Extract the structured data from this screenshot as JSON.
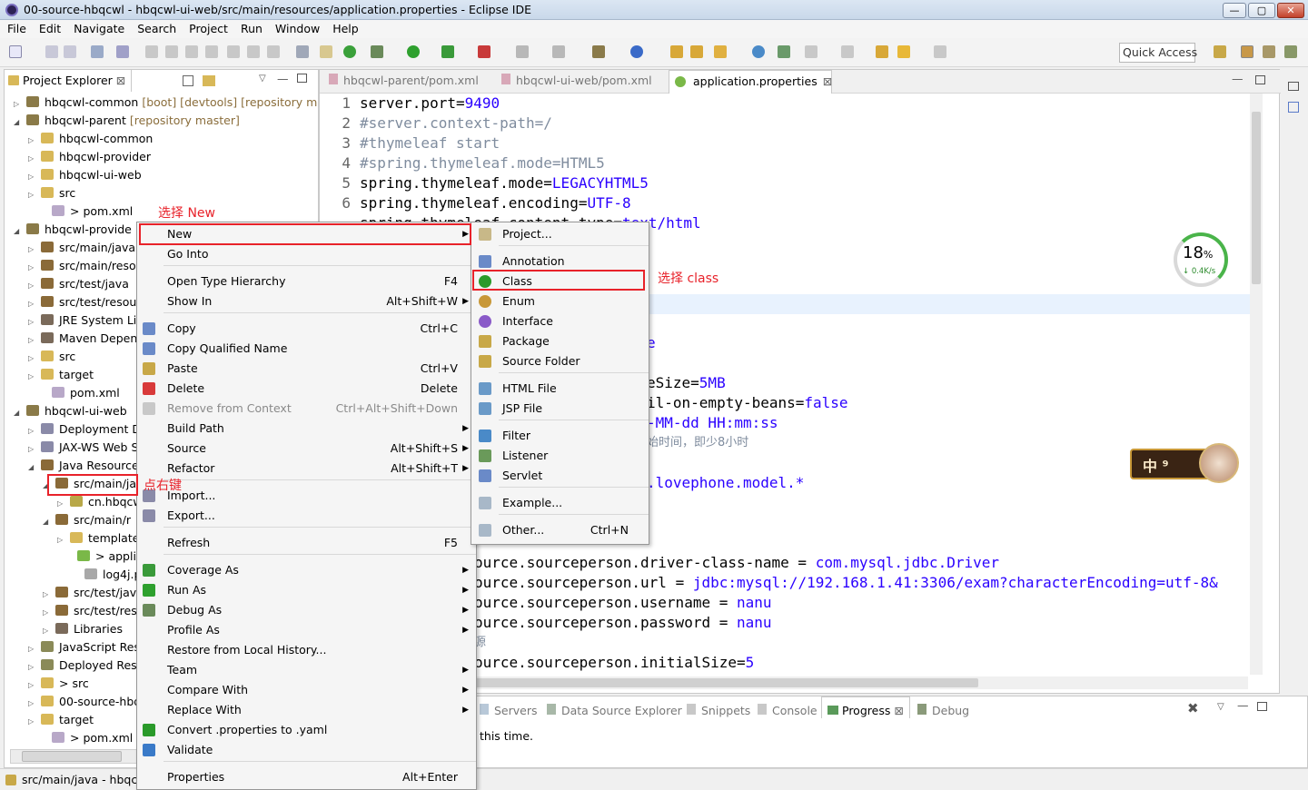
{
  "window": {
    "title": "00-source-hbqcwl - hbqcwl-ui-web/src/main/resources/application.properties - Eclipse IDE",
    "min": "—",
    "max": "▢",
    "close": "✕"
  },
  "menu": [
    "File",
    "Edit",
    "Navigate",
    "Search",
    "Project",
    "Run",
    "Window",
    "Help"
  ],
  "quick_access": "Quick Access",
  "explorer": {
    "tab": "Project Explorer",
    "rows": [
      {
        "t": "hbqcwl-common",
        "d": "[boot] [devtools] [repository ma:"
      },
      {
        "t": "hbqcwl-parent",
        "d": "[repository master]"
      },
      {
        "t": "hbqcwl-common",
        "d": ""
      },
      {
        "t": "hbqcwl-provider",
        "d": ""
      },
      {
        "t": "hbqcwl-ui-web",
        "d": ""
      },
      {
        "t": "src",
        "d": ""
      },
      {
        "t": "> pom.xml",
        "d": ""
      },
      {
        "t": "hbqcwl-provide",
        "d": ""
      },
      {
        "t": "src/main/java",
        "d": ""
      },
      {
        "t": "src/main/resou",
        "d": ""
      },
      {
        "t": "src/test/java",
        "d": ""
      },
      {
        "t": "src/test/resourc",
        "d": ""
      },
      {
        "t": "JRE System Libr",
        "d": ""
      },
      {
        "t": "Maven Depend",
        "d": ""
      },
      {
        "t": "src",
        "d": ""
      },
      {
        "t": "target",
        "d": ""
      },
      {
        "t": "pom.xml",
        "d": ""
      },
      {
        "t": "hbqcwl-ui-web",
        "d": ""
      },
      {
        "t": "Deployment De",
        "d": ""
      },
      {
        "t": "JAX-WS Web Se",
        "d": ""
      },
      {
        "t": "Java Resources",
        "d": ""
      },
      {
        "t": "src/main/java",
        "d": ""
      },
      {
        "t": "cn.hbqcwl",
        "d": ""
      },
      {
        "t": "src/main/r",
        "d": ""
      },
      {
        "t": "templates",
        "d": ""
      },
      {
        "t": "> applicat",
        "d": ""
      },
      {
        "t": "log4j.prop",
        "d": ""
      },
      {
        "t": "src/test/java",
        "d": ""
      },
      {
        "t": "src/test/reso",
        "d": ""
      },
      {
        "t": "Libraries",
        "d": ""
      },
      {
        "t": "JavaScript Reso",
        "d": ""
      },
      {
        "t": "Deployed Reso",
        "d": ""
      },
      {
        "t": "> src",
        "d": ""
      },
      {
        "t": "00-source-hbqc",
        "d": ""
      },
      {
        "t": "target",
        "d": ""
      },
      {
        "t": "> pom.xml",
        "d": ""
      }
    ]
  },
  "editor": {
    "tabs": [
      "hbqcwl-parent/pom.xml",
      "hbqcwl-ui-web/pom.xml",
      "application.properties"
    ],
    "lines": [
      {
        "n": "1",
        "k": "server.port=",
        "v": "9490",
        "c": ""
      },
      {
        "n": "2",
        "k": "",
        "v": "",
        "c": "#server.context-path=/"
      },
      {
        "n": "3",
        "k": "",
        "v": "",
        "c": "#thymeleaf start"
      },
      {
        "n": "4",
        "k": "",
        "v": "",
        "c": "#spring.thymeleaf.mode=HTML5"
      },
      {
        "n": "5",
        "k": "spring.thymeleaf.mode=",
        "v": "LEGACYHTML5",
        "c": ""
      },
      {
        "n": "6",
        "k": "spring.thymeleaf.encoding=",
        "v": "UTF-8",
        "c": ""
      },
      {
        "n": "",
        "k": "spring.thymeleaf.content-type=",
        "v": "text/html",
        "c": ""
      }
    ],
    "frag": {
      "e": "e",
      "size": "eSize=",
      "size_v": "5MB",
      "fail": "il-on-empty-beans=",
      "fail_v": "false",
      "date": "-MM-dd HH:mm:ss",
      "note": "始时间，即少8小时",
      "model": ".lovephone.model.*",
      "ds1k": "ource.sourceperson.driver-class-name",
      "ds1v": "com.mysql.jdbc.Driver",
      "ds2k": "ource.sourceperson.url",
      "ds2v": "jdbc:mysql://192.168.1.41:3306/exam?characterEncoding=utf-8&",
      "ds3k": "ource.sourceperson.username",
      "ds3v": "nanu",
      "ds4k": "ource.sourceperson.password",
      "ds4v": "nanu",
      "src": "源",
      "ds5k": "ource.sourceperson.initialSize=",
      "ds5v": "5",
      "eqs": "="
    }
  },
  "speed": {
    "pct": "18",
    "unit": "%",
    "rate": "↓ 0.4K/s"
  },
  "badge": {
    "text": "中 ⁹"
  },
  "bottom": {
    "tabs": [
      "Servers",
      "Data Source Explorer",
      "Snippets",
      "Console",
      "Progress",
      "Debug"
    ],
    "msg": "this time."
  },
  "status": {
    "text": "src/main/java - hbqcw"
  },
  "context_menu": [
    {
      "l": "New",
      "s": "",
      "a": true
    },
    {
      "l": "Go Into",
      "s": "",
      "a": false
    },
    {
      "l": "Open Type Hierarchy",
      "s": "F4",
      "a": false
    },
    {
      "l": "Show In",
      "s": "Alt+Shift+W",
      "a": true
    },
    {
      "l": "Copy",
      "s": "Ctrl+C",
      "a": false
    },
    {
      "l": "Copy Qualified Name",
      "s": "",
      "a": false
    },
    {
      "l": "Paste",
      "s": "Ctrl+V",
      "a": false
    },
    {
      "l": "Delete",
      "s": "Delete",
      "a": false
    },
    {
      "l": "Remove from Context",
      "s": "Ctrl+Alt+Shift+Down",
      "a": false
    },
    {
      "l": "Build Path",
      "s": "",
      "a": true
    },
    {
      "l": "Source",
      "s": "Alt+Shift+S",
      "a": true
    },
    {
      "l": "Refactor",
      "s": "Alt+Shift+T",
      "a": true
    },
    {
      "l": "Import...",
      "s": "",
      "a": false
    },
    {
      "l": "Export...",
      "s": "",
      "a": false
    },
    {
      "l": "Refresh",
      "s": "F5",
      "a": false
    },
    {
      "l": "Coverage As",
      "s": "",
      "a": true
    },
    {
      "l": "Run As",
      "s": "",
      "a": true
    },
    {
      "l": "Debug As",
      "s": "",
      "a": true
    },
    {
      "l": "Profile As",
      "s": "",
      "a": true
    },
    {
      "l": "Restore from Local History...",
      "s": "",
      "a": false
    },
    {
      "l": "Team",
      "s": "",
      "a": true
    },
    {
      "l": "Compare With",
      "s": "",
      "a": true
    },
    {
      "l": "Replace With",
      "s": "",
      "a": true
    },
    {
      "l": "Convert .properties to .yaml",
      "s": "",
      "a": false
    },
    {
      "l": "Validate",
      "s": "",
      "a": false
    },
    {
      "l": "Properties",
      "s": "Alt+Enter",
      "a": false
    }
  ],
  "submenu": [
    {
      "l": "Project...",
      "s": ""
    },
    {
      "l": "Annotation",
      "s": ""
    },
    {
      "l": "Class",
      "s": ""
    },
    {
      "l": "Enum",
      "s": ""
    },
    {
      "l": "Interface",
      "s": ""
    },
    {
      "l": "Package",
      "s": ""
    },
    {
      "l": "Source Folder",
      "s": ""
    },
    {
      "l": "HTML File",
      "s": ""
    },
    {
      "l": "JSP File",
      "s": ""
    },
    {
      "l": "Filter",
      "s": ""
    },
    {
      "l": "Listener",
      "s": ""
    },
    {
      "l": "Servlet",
      "s": ""
    },
    {
      "l": "Example...",
      "s": ""
    },
    {
      "l": "Other...",
      "s": "Ctrl+N"
    }
  ],
  "annotations": {
    "new": "选择 New",
    "cls": "选择 class",
    "right": "点右键"
  },
  "colors": {
    "accent": "#e8222a",
    "value": "#2a00ff",
    "comment": "#7f8c9e"
  }
}
